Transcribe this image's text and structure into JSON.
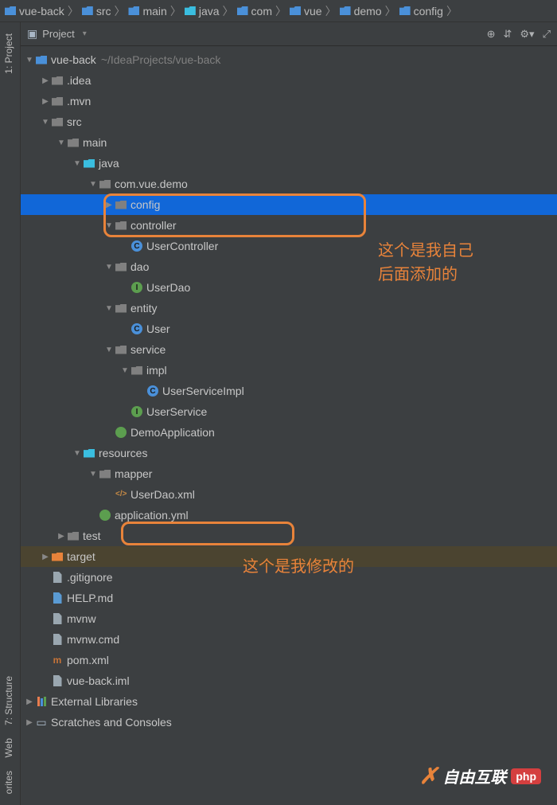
{
  "breadcrumb": {
    "items": [
      {
        "label": "vue-back",
        "icon": "folder"
      },
      {
        "label": "src",
        "icon": "folder"
      },
      {
        "label": "main",
        "icon": "folder"
      },
      {
        "label": "java",
        "icon": "folder-cyan"
      },
      {
        "label": "com",
        "icon": "folder"
      },
      {
        "label": "vue",
        "icon": "folder"
      },
      {
        "label": "demo",
        "icon": "folder"
      },
      {
        "label": "config",
        "icon": "folder"
      }
    ]
  },
  "leftTabs": {
    "top": "1: Project",
    "bottom": [
      "7: Structure",
      "Web",
      "orites"
    ]
  },
  "panel": {
    "title": "Project",
    "icons": [
      "target",
      "collapse",
      "settings",
      "hide"
    ]
  },
  "tree": {
    "root": {
      "name": "vue-back",
      "path": "~/IdeaProjects/vue-back"
    },
    "nodes": [
      {
        "indent": 1,
        "arrow": "right",
        "icon": "folder-gray",
        "label": ".idea"
      },
      {
        "indent": 1,
        "arrow": "right",
        "icon": "folder-gray",
        "label": ".mvn"
      },
      {
        "indent": 1,
        "arrow": "down",
        "icon": "folder-gray",
        "label": "src"
      },
      {
        "indent": 2,
        "arrow": "down",
        "icon": "folder-gray",
        "label": "main"
      },
      {
        "indent": 3,
        "arrow": "down",
        "icon": "folder-cyan",
        "label": "java"
      },
      {
        "indent": 4,
        "arrow": "down",
        "icon": "folder-gray",
        "label": "com.vue.demo"
      },
      {
        "indent": 5,
        "arrow": "right",
        "icon": "folder-gray",
        "label": "config",
        "selected": true
      },
      {
        "indent": 5,
        "arrow": "down",
        "icon": "folder-gray",
        "label": "controller"
      },
      {
        "indent": 6,
        "arrow": "",
        "icon": "class-c",
        "label": "UserController"
      },
      {
        "indent": 5,
        "arrow": "down",
        "icon": "folder-gray",
        "label": "dao"
      },
      {
        "indent": 6,
        "arrow": "",
        "icon": "class-i",
        "label": "UserDao"
      },
      {
        "indent": 5,
        "arrow": "down",
        "icon": "folder-gray",
        "label": "entity"
      },
      {
        "indent": 6,
        "arrow": "",
        "icon": "class-c",
        "label": "User"
      },
      {
        "indent": 5,
        "arrow": "down",
        "icon": "folder-gray",
        "label": "service"
      },
      {
        "indent": 6,
        "arrow": "down",
        "icon": "folder-gray",
        "label": "impl"
      },
      {
        "indent": 7,
        "arrow": "",
        "icon": "class-c",
        "label": "UserServiceImpl"
      },
      {
        "indent": 6,
        "arrow": "",
        "icon": "class-i",
        "label": "UserService"
      },
      {
        "indent": 5,
        "arrow": "",
        "icon": "spring",
        "label": "DemoApplication"
      },
      {
        "indent": 3,
        "arrow": "down",
        "icon": "folder-cyan",
        "label": "resources"
      },
      {
        "indent": 4,
        "arrow": "down",
        "icon": "folder-gray",
        "label": "mapper"
      },
      {
        "indent": 5,
        "arrow": "",
        "icon": "xml",
        "label": "UserDao.xml"
      },
      {
        "indent": 4,
        "arrow": "",
        "icon": "yml",
        "label": "application.yml"
      },
      {
        "indent": 2,
        "arrow": "right",
        "icon": "folder-gray",
        "label": "test"
      },
      {
        "indent": 1,
        "arrow": "right",
        "icon": "folder-orange",
        "label": "target",
        "rowClass": "target-selected"
      },
      {
        "indent": 1,
        "arrow": "",
        "icon": "file",
        "label": ".gitignore"
      },
      {
        "indent": 1,
        "arrow": "",
        "icon": "file-md",
        "label": "HELP.md"
      },
      {
        "indent": 1,
        "arrow": "",
        "icon": "file",
        "label": "mvnw"
      },
      {
        "indent": 1,
        "arrow": "",
        "icon": "file",
        "label": "mvnw.cmd"
      },
      {
        "indent": 1,
        "arrow": "",
        "icon": "file-m",
        "label": "pom.xml"
      },
      {
        "indent": 1,
        "arrow": "",
        "icon": "file",
        "label": "vue-back.iml"
      }
    ],
    "ext": [
      {
        "label": "External Libraries",
        "icon": "lib"
      },
      {
        "label": "Scratches and Consoles",
        "icon": "scratch"
      }
    ]
  },
  "annotations": {
    "top": "这个是我自己\n后面添加的",
    "bottom": "这个是我修改的"
  },
  "watermark": {
    "brand": "自由互联",
    "tag": "php"
  }
}
